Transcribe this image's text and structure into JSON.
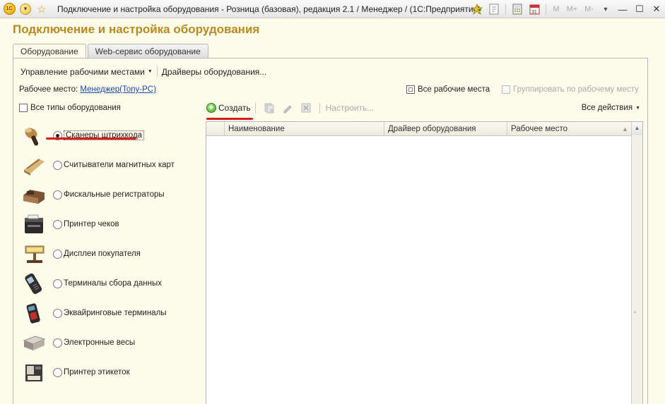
{
  "window": {
    "title": "Подключение и настройка оборудования - Розница (базовая), редакция 2.1 / Менеджер /  (1С:Предприятие)",
    "logo_text": "1С",
    "m_buttons": [
      "M",
      "M+",
      "M-"
    ]
  },
  "form": {
    "title": "Подключение и настройка оборудования"
  },
  "tabs": [
    {
      "label": "Оборудование",
      "active": true
    },
    {
      "label": "Web-сервис оборудование",
      "active": false
    }
  ],
  "commandbar": {
    "workplaces_label": "Управление рабочими местами",
    "drivers_label": "Драйверы оборудования..."
  },
  "workplace": {
    "label": "Рабочее место:",
    "value": "Менеджер(Tony-PC)"
  },
  "all_workplaces_label": "Все рабочие места",
  "group_by_workplace_label": "Группировать по рабочему месту",
  "all_types_label": "Все типы оборудования",
  "equipment_types": [
    {
      "label": "Сканеры штрихкода",
      "selected": true,
      "icon": "barcode-scanner-icon"
    },
    {
      "label": "Считыватели магнитных карт",
      "selected": false,
      "icon": "card-reader-icon"
    },
    {
      "label": "Фискальные регистраторы",
      "selected": false,
      "icon": "fiscal-register-icon"
    },
    {
      "label": "Принтер чеков",
      "selected": false,
      "icon": "receipt-printer-icon"
    },
    {
      "label": "Дисплеи покупателя",
      "selected": false,
      "icon": "customer-display-icon"
    },
    {
      "label": "Терминалы сбора данных",
      "selected": false,
      "icon": "data-terminal-icon"
    },
    {
      "label": "Эквайринговые терминалы",
      "selected": false,
      "icon": "acquiring-terminal-icon"
    },
    {
      "label": "Электронные весы",
      "selected": false,
      "icon": "scales-icon"
    },
    {
      "label": "Принтер этикеток",
      "selected": false,
      "icon": "label-printer-icon"
    }
  ],
  "toolbar": {
    "create_label": "Создать",
    "setup_label": "Настроить...",
    "all_actions_label": "Все действия"
  },
  "table": {
    "columns": [
      "Наименование",
      "Драйвер оборудования",
      "Рабочее место"
    ],
    "rows": []
  },
  "colors": {
    "form_bg": "#fdfbea",
    "title_gold": "#b58a20",
    "link_blue": "#1c48a6",
    "highlight_red": "#d91a1a"
  }
}
